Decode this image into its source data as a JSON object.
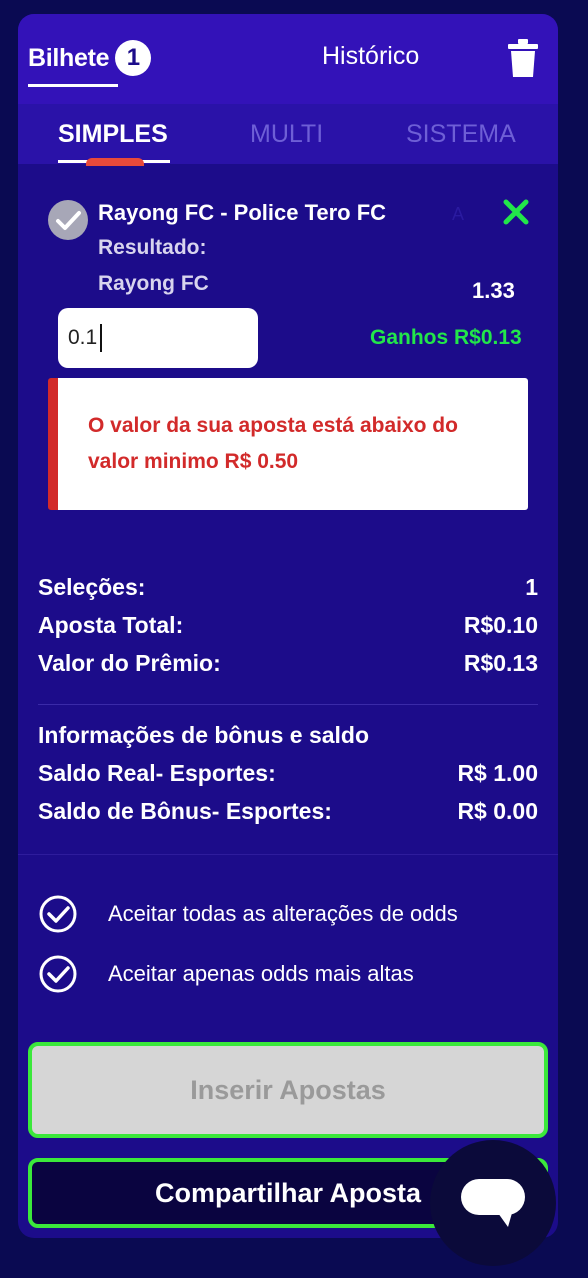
{
  "header": {
    "tab_bilhete": "Bilhete",
    "bilhete_count": "1",
    "tab_historico": "Histórico"
  },
  "subtabs": [
    "SIMPLES",
    "MULTI",
    "SISTEMA"
  ],
  "bet": {
    "match": "Rayong FC - Police Tero FC",
    "marker": "A",
    "market": "Resultado:",
    "selection": "Rayong FC",
    "odds": "1.33",
    "stake_value": "0.1",
    "gains": "Ganhos R$0.13",
    "alert": "O valor da sua aposta está abaixo do valor minimo R$ 0.50"
  },
  "summary": {
    "selecoes_label": "Seleções:",
    "selecoes_value": "1",
    "aposta_label": "Aposta Total:",
    "aposta_value": "R$0.10",
    "premio_label": "Valor do Prêmio:",
    "premio_value": "R$0.13",
    "bonus_header": "Informações de bônus e saldo",
    "saldo_real_label": "Saldo Real- Esportes:",
    "saldo_real_value": "R$ 1.00",
    "saldo_bonus_label": "Saldo de Bônus- Esportes:",
    "saldo_bonus_value": "R$ 0.00"
  },
  "options": {
    "accept_all": "Aceitar todas as alterações de odds",
    "accept_higher": "Aceitar apenas odds mais altas"
  },
  "buttons": {
    "insert": "Inserir Apostas",
    "share": "Compartilhar Aposta"
  },
  "colors": {
    "panel": "#1c0c8a",
    "header": "#3312b8",
    "accent_green": "#3be83b",
    "alert_red": "#d22a2a"
  },
  "icons": [
    "trash-icon",
    "check-circle-icon",
    "close-icon",
    "checkbox-checked-icon",
    "chat-icon"
  ]
}
